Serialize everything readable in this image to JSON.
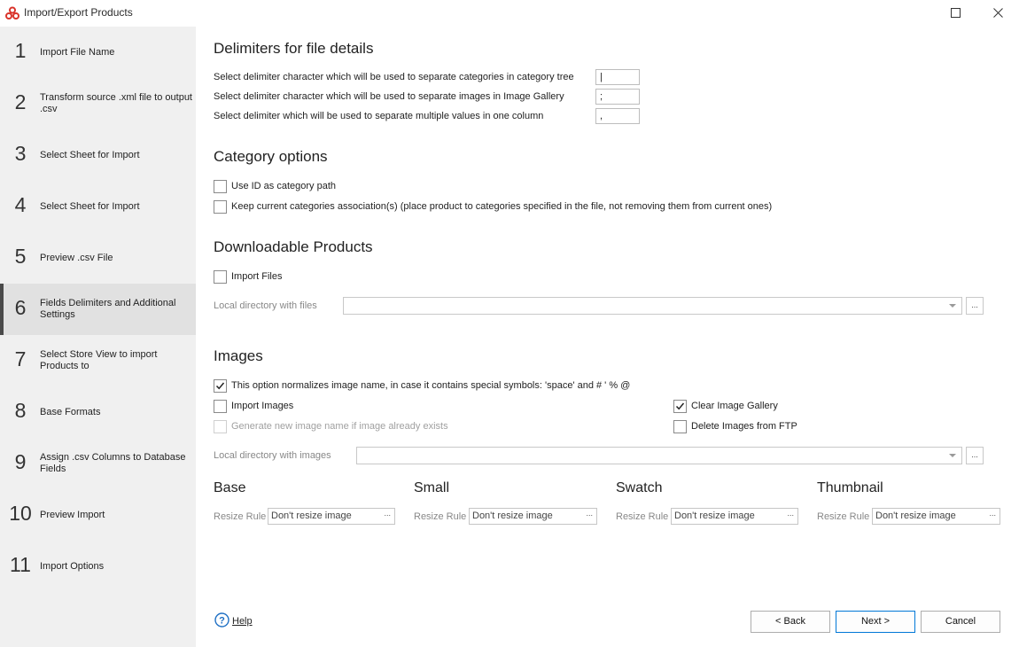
{
  "window": {
    "title": "Import/Export Products",
    "brand_color": "#d9342b"
  },
  "sidebar": {
    "active_index": 5,
    "steps": [
      {
        "num": "1",
        "label": "Import File Name"
      },
      {
        "num": "2",
        "label": "Transform source .xml file to output .csv"
      },
      {
        "num": "3",
        "label": "Select Sheet for Import"
      },
      {
        "num": "4",
        "label": "Select Sheet for Import"
      },
      {
        "num": "5",
        "label": "Preview .csv File"
      },
      {
        "num": "6",
        "label": "Fields Delimiters and Additional Settings"
      },
      {
        "num": "7",
        "label": "Select Store View to import Products to"
      },
      {
        "num": "8",
        "label": "Base Formats"
      },
      {
        "num": "9",
        "label": "Assign .csv Columns to Database Fields"
      },
      {
        "num": "10",
        "label": "Preview Import"
      },
      {
        "num": "11",
        "label": "Import Options"
      }
    ]
  },
  "delimiters": {
    "title": "Delimiters for file details",
    "category_label": "Select delimiter character which will be used to separate categories in category tree",
    "category_value": "|",
    "images_label": "Select delimiter character which will be used to separate images in Image Gallery",
    "images_value": ";",
    "multi_label": "Select delimiter which will be used to separate multiple values in one column",
    "multi_value": ","
  },
  "category_options": {
    "title": "Category options",
    "use_id_label": "Use ID as category path",
    "use_id_checked": false,
    "keep_current_label": "Keep current categories association(s) (place product to categories specified in the file, not removing them from current ones)",
    "keep_current_checked": false
  },
  "downloadable": {
    "title": "Downloadable Products",
    "import_files_label": "Import Files",
    "import_files_checked": false,
    "local_dir_label": "Local directory with files",
    "local_dir_value": "",
    "browse_label": "..."
  },
  "images": {
    "title": "Images",
    "normalize_label": "This option normalizes image name, in case it contains special symbols: 'space' and # ' % @",
    "normalize_checked": true,
    "import_images_label": "Import Images",
    "import_images_checked": false,
    "generate_name_label": "Generate new image name if image already exists",
    "generate_name_checked": false,
    "clear_gallery_label": "Clear Image Gallery",
    "clear_gallery_checked": true,
    "delete_ftp_label": "Delete Images from FTP",
    "delete_ftp_checked": false,
    "local_dir_label": "Local directory with images",
    "local_dir_value": "",
    "browse_label": "..."
  },
  "resize": {
    "rule_label": "Resize Rule",
    "groups": [
      {
        "title": "Base",
        "value": "Don't resize image"
      },
      {
        "title": "Small",
        "value": "Don't resize image"
      },
      {
        "title": "Swatch",
        "value": "Don't resize image"
      },
      {
        "title": "Thumbnail",
        "value": "Don't resize image"
      }
    ],
    "ellipsis": "..."
  },
  "footer": {
    "help_label": "Help",
    "back_label": "< Back",
    "next_label": "Next >",
    "cancel_label": "Cancel"
  }
}
